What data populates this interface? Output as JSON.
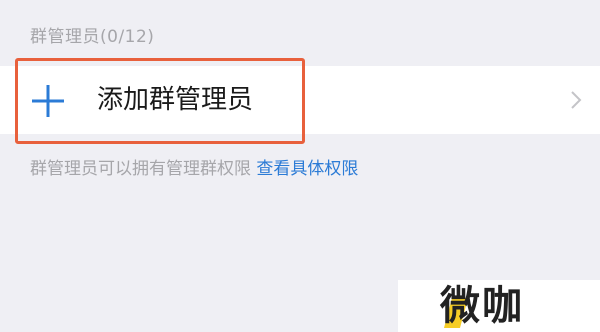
{
  "section": {
    "header": "群管理员(0/12)"
  },
  "add_row": {
    "label": "添加群管理员",
    "icon": "plus-icon",
    "chevron_icon": "chevron-right-icon"
  },
  "footer": {
    "note": "群管理员可以拥有管理群权限",
    "link": "查看具体权限"
  },
  "watermark": {
    "text": "微咖"
  },
  "colors": {
    "background": "#efeff4",
    "accent_blue": "#2b7bd6",
    "highlight_orange": "#e8603c",
    "muted_text": "#a6a6aa"
  }
}
